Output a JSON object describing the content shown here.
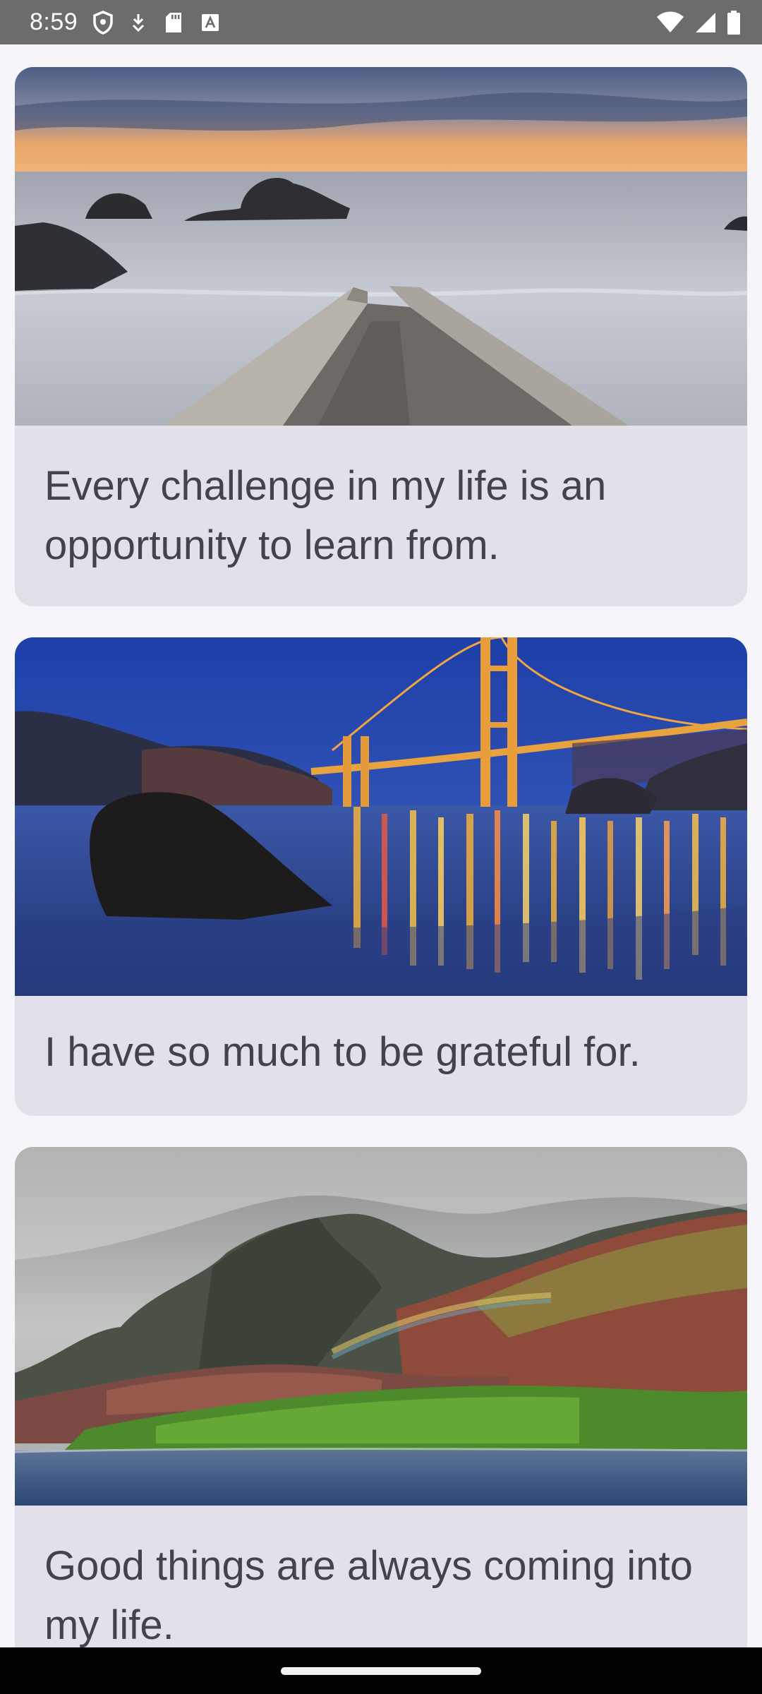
{
  "status_bar": {
    "time": "8:59",
    "left_icons": [
      "shield-icon",
      "download-arrow-icon",
      "sd-card-icon",
      "keyboard-a-icon"
    ],
    "right_icons": [
      "wifi-icon",
      "cell-signal-icon",
      "battery-icon"
    ]
  },
  "feed": {
    "cards": [
      {
        "image": "seascape-sunset-pier-image",
        "text": "Every challenge in my life is an opportunity to learn from."
      },
      {
        "image": "golden-gate-bridge-night-image",
        "text": "I have so much to be grateful for."
      },
      {
        "image": "mountain-rainbow-coast-image",
        "text": "Good things are always coming into my life."
      }
    ]
  },
  "colors": {
    "background": "#f6f5fa",
    "card_background": "#e2e1ea",
    "card_text": "#43434d",
    "status_bar": "#6c6c6c"
  }
}
